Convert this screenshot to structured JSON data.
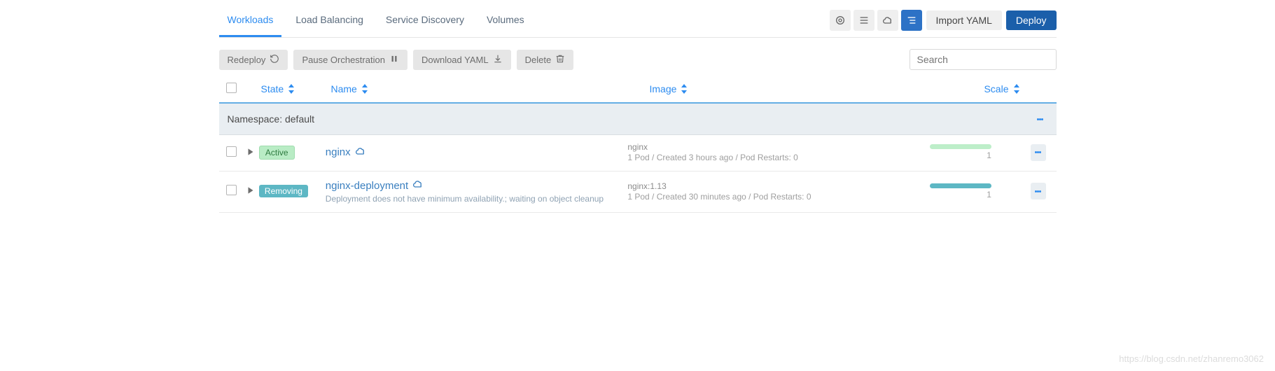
{
  "tabs": [
    {
      "label": "Workloads",
      "active": true
    },
    {
      "label": "Load Balancing",
      "active": false
    },
    {
      "label": "Service Discovery",
      "active": false
    },
    {
      "label": "Volumes",
      "active": false
    }
  ],
  "topButtons": {
    "importYaml": "Import YAML",
    "deploy": "Deploy"
  },
  "actions": {
    "redeploy": "Redeploy",
    "pause": "Pause Orchestration",
    "download": "Download YAML",
    "delete": "Delete"
  },
  "search": {
    "placeholder": "Search"
  },
  "columns": {
    "state": "State",
    "name": "Name",
    "image": "Image",
    "scale": "Scale"
  },
  "group": {
    "label": "Namespace: default"
  },
  "rows": [
    {
      "state": {
        "text": "Active",
        "kind": "active"
      },
      "name": "nginx",
      "nameSub": "",
      "image": "nginx",
      "imageSub": "1 Pod / Created 3 hours ago / Pod Restarts: 0",
      "scale": {
        "count": "1",
        "kind": "green"
      }
    },
    {
      "state": {
        "text": "Removing",
        "kind": "removing"
      },
      "name": "nginx-deployment",
      "nameSub": "Deployment does not have minimum availability.; waiting on object cleanup",
      "image": "nginx:1.13",
      "imageSub": "1 Pod / Created 30 minutes ago / Pod Restarts: 0",
      "scale": {
        "count": "1",
        "kind": "teal"
      }
    }
  ],
  "watermark": "https://blog.csdn.net/zhanremo3062"
}
